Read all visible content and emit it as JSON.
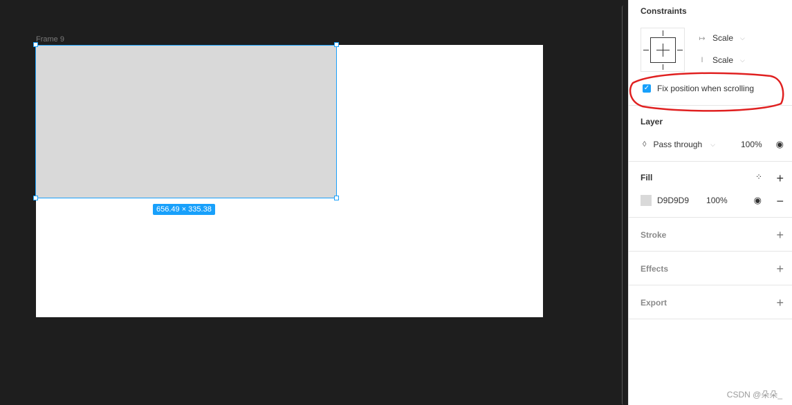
{
  "canvas": {
    "frame_label": "Frame 9",
    "dimensions_badge": "656.49 × 335.38"
  },
  "panel": {
    "constraints": {
      "title": "Constraints",
      "horizontal": "Scale",
      "vertical": "Scale",
      "fix_position_label": "Fix position when scrolling",
      "fix_position_checked": true
    },
    "layer": {
      "title": "Layer",
      "blend_mode": "Pass through",
      "opacity": "100%"
    },
    "fill": {
      "title": "Fill",
      "color_hex": "D9D9D9",
      "swatch": "#d9d9d9",
      "opacity": "100%"
    },
    "stroke": {
      "title": "Stroke"
    },
    "effects": {
      "title": "Effects"
    },
    "export": {
      "title": "Export"
    }
  },
  "watermark": "CSDN @朵朵_",
  "colors": {
    "accent": "#18a0fb",
    "annotation": "#e02020"
  }
}
